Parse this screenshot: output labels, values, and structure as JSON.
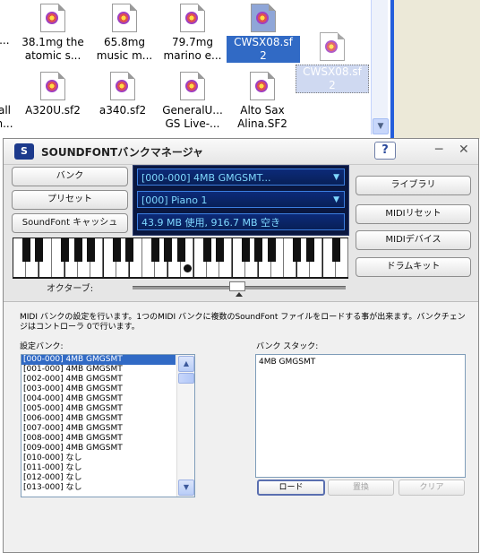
{
  "explorer": {
    "files": [
      {
        "label": "38.1mg the\natomic s..."
      },
      {
        "label": "65.8mg\nmusic m..."
      },
      {
        "label": "79.7mg\nmarino e..."
      },
      {
        "label": "CWSX08.sf\n2",
        "selected": true
      },
      {
        "label": "CWSX08.sf\n2",
        "ghost": true
      },
      {
        "label": "A320U.sf2"
      },
      {
        "label": "a340.sf2"
      },
      {
        "label": "GeneralU...\nGS Live-..."
      },
      {
        "label": "Alto Sax\nAlina.SF2"
      }
    ],
    "partial_labels": {
      "n": "n...",
      "all": "all\nn..."
    },
    "scroll_down_arrow": "▼"
  },
  "sf": {
    "title": "SOUNDFONTバンクマネージャ",
    "logo": "S",
    "help": "?",
    "min": "─",
    "close": "✕",
    "buttons_left": {
      "bank": "バンク",
      "preset": "プリセット",
      "cache": "SoundFont キャッシュ"
    },
    "lcd": {
      "bank_value": "[000-000] 4MB GMGSMT...",
      "preset_value": "[000] Piano 1",
      "memory": "43.9 MB 使用, 916.7 MB 空き"
    },
    "buttons_right": {
      "library": "ライブラリ",
      "midi_reset": "MIDIリセット",
      "midi_device": "MIDIデバイス",
      "drum_kit": "ドラムキット"
    },
    "octave_label": "オクターブ:",
    "description": "MIDI バンクの設定を行います。1つのMIDI バンクに複数のSoundFont ファイルをロードする事が出来ます。バンクチェンジはコントローラ 0で行います。",
    "bank_label": "設定バンク:",
    "stack_label": "バンク スタック:",
    "bank_list": [
      "[000-000] 4MB GMGSMT",
      "[001-000] 4MB GMGSMT",
      "[002-000] 4MB GMGSMT",
      "[003-000] 4MB GMGSMT",
      "[004-000] 4MB GMGSMT",
      "[005-000] 4MB GMGSMT",
      "[006-000] 4MB GMGSMT",
      "[007-000] 4MB GMGSMT",
      "[008-000] 4MB GMGSMT",
      "[009-000] 4MB GMGSMT",
      "[010-000] なし",
      "[011-000] なし",
      "[012-000] なし",
      "[013-000] なし"
    ],
    "stack_list": [
      "4MB GMGSMT"
    ],
    "bottom_buttons": {
      "load": "ロード",
      "replace": "置換",
      "clear": "クリア"
    },
    "scroll_up": "▲",
    "scroll_down": "▼"
  }
}
